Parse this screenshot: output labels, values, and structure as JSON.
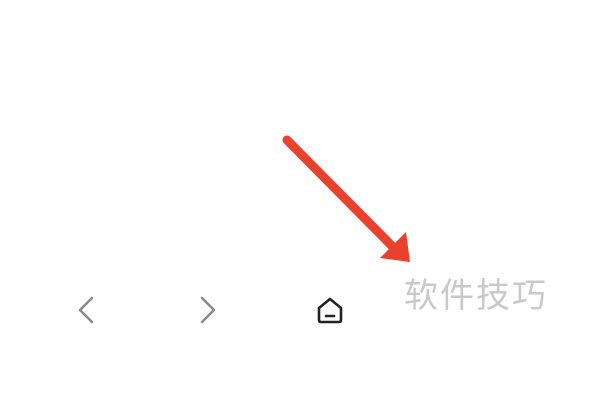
{
  "colors": {
    "background": "#ffffff",
    "arrow": "#e8412c",
    "nav_icon": "#8a8a8a",
    "home_icon": "#222222",
    "watermark": "#c9c9c9"
  },
  "navigation": {
    "back_icon": "chevron-left-icon",
    "forward_icon": "chevron-right-icon",
    "home_icon": "home-icon"
  },
  "watermark": {
    "text": "软件技巧"
  }
}
